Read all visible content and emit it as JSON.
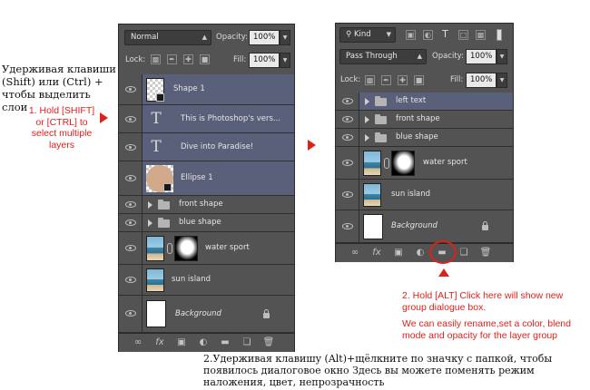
{
  "annotations": {
    "ru_shift": "Удерживая клавиши (Shift) или (Ctrl) + чтобы выделить слои",
    "en_shift": "1. Hold [SHIFT] or [CTRL] to select multiple layers",
    "en_alt_1": "2. Hold [ALT] Click here will show new group dialogue box.",
    "en_alt_2": "We can easily rename,set a color, blend mode and opacity for the layer group",
    "ru_alt": "2.Удерживая клавишу (Alt)+щёлкните по значку с папкой, чтобы появилось диалоговое окно Здесь вы можете поменять режим наложения, цвет, непрозрачность"
  },
  "left_panel": {
    "blend_mode": "Normal",
    "opacity_label": "Opacity:",
    "opacity_value": "100%",
    "lock_label": "Lock:",
    "fill_label": "Fill:",
    "fill_value": "100%",
    "layers": [
      {
        "name": "Shape 1",
        "type": "shape",
        "selected": true
      },
      {
        "name": "This is Photoshop's vers...",
        "type": "text",
        "selected": true
      },
      {
        "name": "Dive into Paradise!",
        "type": "text",
        "selected": true
      },
      {
        "name": "Ellipse 1",
        "type": "ellipse",
        "selected": true
      },
      {
        "name": "front shape",
        "type": "group",
        "selected": false
      },
      {
        "name": "blue shape",
        "type": "group",
        "selected": false
      },
      {
        "name": "water sport",
        "type": "masked",
        "selected": false
      },
      {
        "name": "sun island",
        "type": "image",
        "selected": false
      },
      {
        "name": "Background",
        "type": "background",
        "selected": false
      }
    ],
    "footer_icons": [
      "link-icon",
      "fx-icon",
      "mask-icon",
      "adjustment-icon",
      "group-folder-icon",
      "new-layer-icon",
      "trash-icon"
    ]
  },
  "right_panel": {
    "filter_kind": "Kind",
    "blend_mode": "Pass Through",
    "opacity_label": "Opacity:",
    "opacity_value": "100%",
    "lock_label": "Lock:",
    "fill_label": "Fill:",
    "fill_value": "100%",
    "layers": [
      {
        "name": "left text",
        "type": "group",
        "selected": true
      },
      {
        "name": "front shape",
        "type": "group",
        "selected": false
      },
      {
        "name": "blue shape",
        "type": "group",
        "selected": false
      },
      {
        "name": "water sport",
        "type": "masked",
        "selected": false
      },
      {
        "name": "sun island",
        "type": "image",
        "selected": false
      },
      {
        "name": "Background",
        "type": "background",
        "selected": false
      }
    ],
    "footer_icons": [
      "link-icon",
      "fx-icon",
      "mask-icon",
      "adjustment-icon",
      "group-folder-icon",
      "new-layer-icon",
      "trash-icon"
    ]
  },
  "colors": {
    "accent_red": "#e0201a",
    "selection": "#5a6079",
    "panel": "#535353"
  }
}
